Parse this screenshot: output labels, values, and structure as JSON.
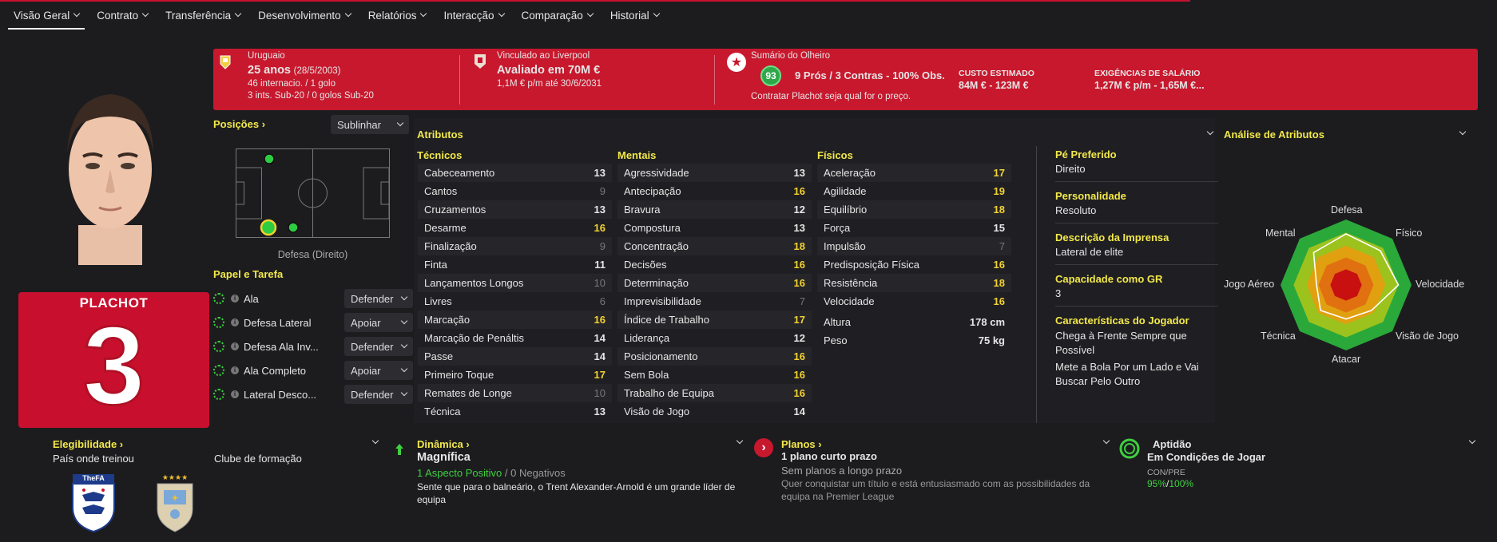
{
  "nav": {
    "items": [
      "Visão Geral",
      "Contrato",
      "Transferência",
      "Desenvolvimento",
      "Relatórios",
      "Interacção",
      "Comparação",
      "Historial"
    ]
  },
  "banner": {
    "nation": "Uruguaio",
    "age": "25 anos",
    "dob": "(28/5/2003)",
    "caps": "46 internacio. / 1 golo",
    "u20": "3 ints. Sub-20 / 0 golos Sub-20",
    "club_line": "Vinculado ao Liverpool",
    "value": "Avaliado em 70M €",
    "wage": "1,1M € p/m até 30/6/2031",
    "scout_title": "Sumário do Olheiro",
    "scout_score": "93",
    "scout_summary": "9 Prós / 3 Contras - 100% Obs.",
    "scout_rec": "Contratar Plachot seja qual for o preço.",
    "cost_label": "CUSTO ESTIMADO",
    "cost_value": "84M € - 123M €",
    "wage_label": "EXIGÊNCIAS DE SALÁRIO",
    "wage_value": "1,27M € p/m - 1,65M €..."
  },
  "player": {
    "name": "PLACHOT",
    "number": "3"
  },
  "positions": {
    "title": "Posições",
    "highlight_value": "Sublinhar",
    "pitch_caption": "Defesa (Direito)"
  },
  "roles": {
    "title": "Papel e Tarefa",
    "items": [
      {
        "role": "Ala",
        "duty": "Defender"
      },
      {
        "role": "Defesa Lateral",
        "duty": "Apoiar"
      },
      {
        "role": "Defesa Ala Inv...",
        "duty": "Defender"
      },
      {
        "role": "Ala Completo",
        "duty": "Apoiar"
      },
      {
        "role": "Lateral Desco...",
        "duty": "Defender"
      }
    ]
  },
  "attributes": {
    "title": "Atributos",
    "technical_title": "Técnicos",
    "mental_title": "Mentais",
    "physical_title": "Físicos",
    "technical": [
      {
        "name": "Cabeceamento",
        "value": "13"
      },
      {
        "name": "Cantos",
        "value": "9"
      },
      {
        "name": "Cruzamentos",
        "value": "13"
      },
      {
        "name": "Desarme",
        "value": "16"
      },
      {
        "name": "Finalização",
        "value": "9"
      },
      {
        "name": "Finta",
        "value": "11"
      },
      {
        "name": "Lançamentos Longos",
        "value": "10"
      },
      {
        "name": "Livres",
        "value": "6"
      },
      {
        "name": "Marcação",
        "value": "16"
      },
      {
        "name": "Marcação de Penáltis",
        "value": "14"
      },
      {
        "name": "Passe",
        "value": "14"
      },
      {
        "name": "Primeiro Toque",
        "value": "17"
      },
      {
        "name": "Remates de Longe",
        "value": "10"
      },
      {
        "name": "Técnica",
        "value": "13"
      }
    ],
    "mental": [
      {
        "name": "Agressividade",
        "value": "13"
      },
      {
        "name": "Antecipação",
        "value": "16"
      },
      {
        "name": "Bravura",
        "value": "12"
      },
      {
        "name": "Compostura",
        "value": "13"
      },
      {
        "name": "Concentração",
        "value": "18"
      },
      {
        "name": "Decisões",
        "value": "16"
      },
      {
        "name": "Determinação",
        "value": "16"
      },
      {
        "name": "Imprevisibilidade",
        "value": "7"
      },
      {
        "name": "Índice de Trabalho",
        "value": "17"
      },
      {
        "name": "Liderança",
        "value": "12"
      },
      {
        "name": "Posicionamento",
        "value": "16"
      },
      {
        "name": "Sem Bola",
        "value": "16"
      },
      {
        "name": "Trabalho de Equipa",
        "value": "16"
      },
      {
        "name": "Visão de Jogo",
        "value": "14"
      }
    ],
    "physical": [
      {
        "name": "Aceleração",
        "value": "17"
      },
      {
        "name": "Agilidade",
        "value": "19"
      },
      {
        "name": "Equilíbrio",
        "value": "18"
      },
      {
        "name": "Força",
        "value": "15"
      },
      {
        "name": "Impulsão",
        "value": "7"
      },
      {
        "name": "Predisposição Física",
        "value": "16"
      },
      {
        "name": "Resistência",
        "value": "18"
      },
      {
        "name": "Velocidade",
        "value": "16"
      }
    ],
    "height_label": "Altura",
    "height_value": "178 cm",
    "weight_label": "Peso",
    "weight_value": "75 kg"
  },
  "info": {
    "foot_label": "Pé Preferido",
    "foot_value": "Direito",
    "personality_label": "Personalidade",
    "personality_value": "Resoluto",
    "press_label": "Descrição da Imprensa",
    "press_value": "Lateral de elite",
    "gk_label": "Capacidade como GR",
    "gk_value": "3",
    "traits_label": "Características do Jogador",
    "trait1": "Chega à Frente Sempre que Possível",
    "trait2": "Mete a Bola Por um Lado e Vai Buscar Pelo Outro"
  },
  "analysis": {
    "title": "Análise de Atributos",
    "labels": [
      "Defesa",
      "Físico",
      "Velocidade",
      "Visão de Jogo",
      "Atacar",
      "Técnica",
      "Jogo Aéreo",
      "Mental"
    ],
    "values": [
      0.78,
      0.74,
      0.8,
      0.55,
      0.52,
      0.55,
      0.45,
      0.7
    ]
  },
  "bottom": {
    "eligibility_title": "Elegibilidade",
    "eligibility_sub": "País onde treinou",
    "training_club": "Clube de formação",
    "fa_text": "TheFA",
    "dynamics_title": "Dinâmica",
    "dynamics_value": "Magnífica",
    "dynamics_pos": "1 Aspecto Positivo",
    "dynamics_sep": "/",
    "dynamics_neg": "0 Negativos",
    "dynamics_desc": "Sente que para o balneário, o Trent Alexander-Arnold é um grande líder de equipa",
    "plans_title": "Planos",
    "plans_value": "1 plano curto prazo",
    "plans_long": "Sem planos a longo prazo",
    "plans_desc": "Quer conquistar um título e está entusiasmado com as possibilidades da equipa na Premier League",
    "fitness_title": "Aptidão",
    "fitness_value": "Em Condições de Jogar",
    "fitness_label": "CON/PRE",
    "fitness_con": "95%",
    "fitness_sep": "/",
    "fitness_pre": "100%"
  },
  "colors": {
    "accent": "#c8182d",
    "highlight": "#f2e84a",
    "green": "#3fcf3f"
  }
}
